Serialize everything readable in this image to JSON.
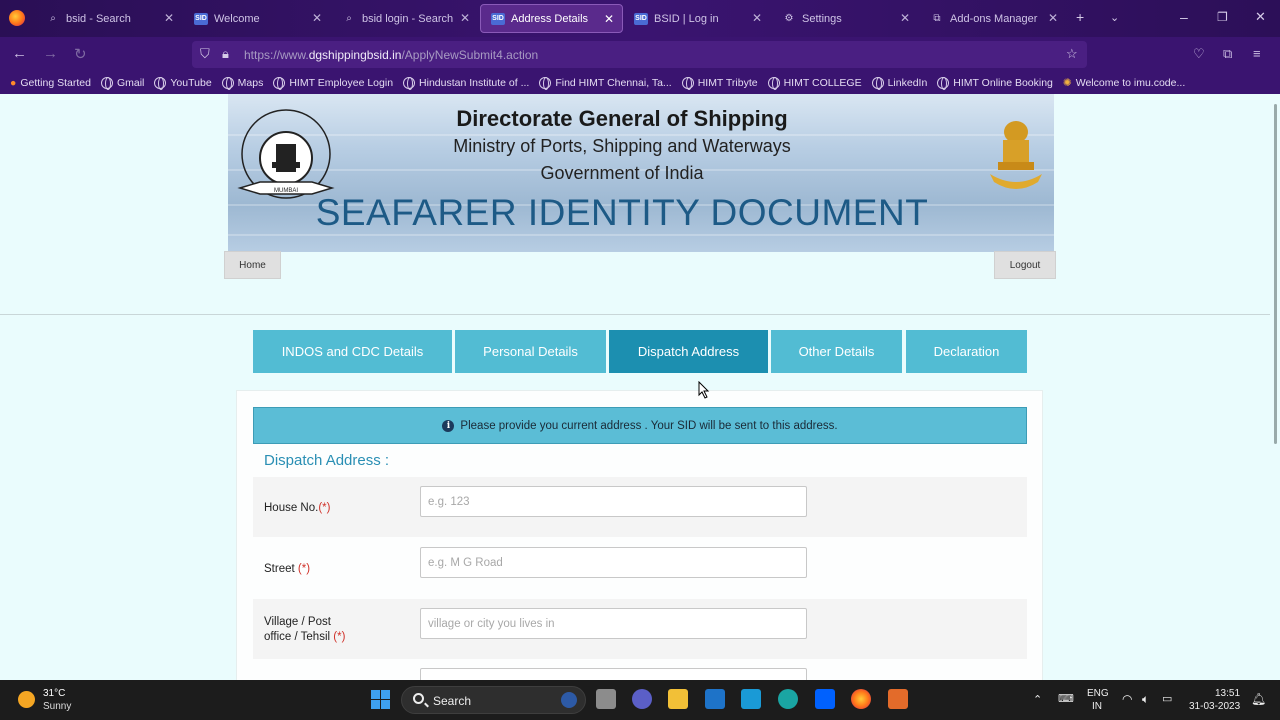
{
  "browser": {
    "tabs": [
      {
        "label": "bsid - Search",
        "icon": "search-icon"
      },
      {
        "label": "Welcome",
        "icon": "sid-icon"
      },
      {
        "label": "bsid login - Search",
        "icon": "search-icon"
      },
      {
        "label": "Address Details",
        "icon": "sid-icon"
      },
      {
        "label": "BSID | Log in",
        "icon": "sid-icon"
      },
      {
        "label": "Settings",
        "icon": "gear-icon"
      },
      {
        "label": "Add-ons Manager",
        "icon": "puzzle-icon"
      }
    ],
    "url_prefix": "https://www.",
    "url_domain": "dgshippingbsid.in",
    "url_path": "/ApplyNewSubmit4.action",
    "bookmarks": [
      "Getting Started",
      "Gmail",
      "YouTube",
      "Maps",
      "HIMT Employee Login",
      "Hindustan Institute of ...",
      "Find HIMT Chennai, Ta...",
      "HIMT Tribyte",
      "HIMT COLLEGE",
      "LinkedIn",
      "HIMT Online Booking",
      "Welcome to imu.code..."
    ]
  },
  "header": {
    "line1": "Directorate General of Shipping",
    "line2": "Ministry of Ports, Shipping and Waterways",
    "line3": "Government of India",
    "line4": "SEAFARER IDENTITY DOCUMENT",
    "logo_caption": "MUMBAI"
  },
  "nav": {
    "home": "Home",
    "logout": "Logout"
  },
  "wizard": {
    "tabs": [
      "INDOS and CDC Details",
      "Personal Details",
      "Dispatch Address",
      "Other Details",
      "Declaration"
    ],
    "active_index": 2
  },
  "form": {
    "info": "Please provide you current address . Your SID will be sent to this address.",
    "section_title": "Dispatch Address :",
    "required_mark": "(*)",
    "fields": [
      {
        "label": "House No.",
        "placeholder": "e.g. 123"
      },
      {
        "label": "Street ",
        "placeholder": "e.g. M G Road"
      },
      {
        "label_line1": "Village / Post",
        "label_line2": "office / Tehsil ",
        "placeholder": "village or city you lives in"
      }
    ]
  },
  "taskbar": {
    "temp": "31°C",
    "weather": "Sunny",
    "search": "Search",
    "lang1": "ENG",
    "lang2": "IN",
    "time": "13:51",
    "date": "31-03-2023"
  },
  "colors": {
    "tab_normal": "#52bcd3",
    "tab_active": "#1c8fb0",
    "required": "#d0322a",
    "page_bg": "#eafcfd"
  }
}
